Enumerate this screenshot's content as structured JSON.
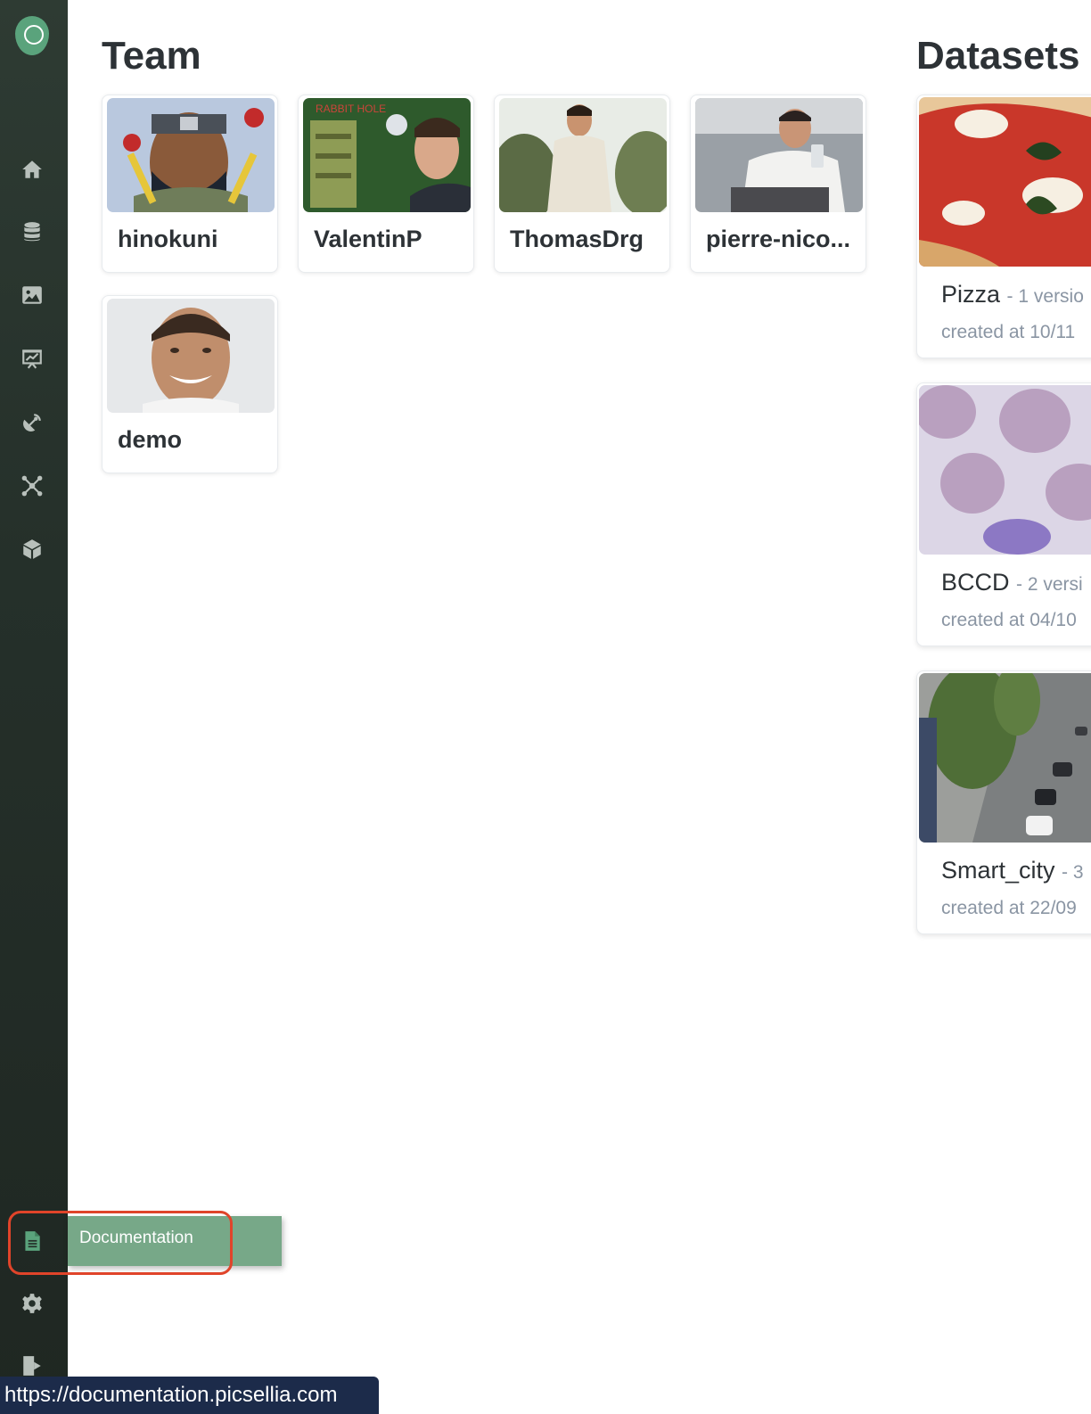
{
  "sidebar": {
    "logo": "picsellia-logo",
    "items": [
      {
        "icon": "home-icon"
      },
      {
        "icon": "database-icon"
      },
      {
        "icon": "image-icon"
      },
      {
        "icon": "presentation-chart-icon"
      },
      {
        "icon": "satellite-dish-icon"
      },
      {
        "icon": "network-icon"
      },
      {
        "icon": "cube-icon"
      }
    ],
    "bottom_items": [
      {
        "icon": "document-icon",
        "label": "Documentation"
      },
      {
        "icon": "gear-icon"
      },
      {
        "icon": "logout-icon"
      }
    ]
  },
  "team": {
    "title": "Team",
    "members": [
      {
        "name": "hinokuni"
      },
      {
        "name": "ValentinP"
      },
      {
        "name": "ThomasDrg"
      },
      {
        "name": "pierre-nico..."
      },
      {
        "name": "demo"
      }
    ]
  },
  "datasets": {
    "title": "Datasets",
    "items": [
      {
        "name": "Pizza",
        "versions": "- 1 versio",
        "created": "created at 10/11"
      },
      {
        "name": "BCCD",
        "versions": "- 2 versi",
        "created": "created at 04/10"
      },
      {
        "name": "Smart_city",
        "versions": "- 3",
        "created": "created at 22/09"
      }
    ]
  },
  "tooltip": {
    "label": "Documentation"
  },
  "status_bar": {
    "url": "https://documentation.picsellia.com"
  },
  "colors": {
    "sidebar": "#25302a",
    "accent": "#5aa37c",
    "tooltip": "#77a888",
    "highlight": "#e0442a",
    "status_bar": "#1c2b4a"
  }
}
